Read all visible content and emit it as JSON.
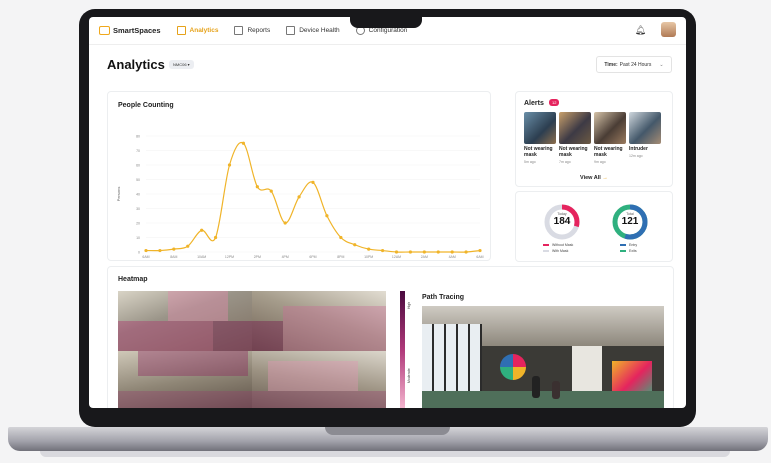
{
  "nav": {
    "brand": "SmartSpaces",
    "items": [
      {
        "label": "Analytics",
        "active": true
      },
      {
        "label": "Reports",
        "active": false
      },
      {
        "label": "Device Health",
        "active": false
      },
      {
        "label": "Configuration",
        "active": false
      }
    ]
  },
  "header": {
    "title": "Analytics",
    "site": "NMC06 ▾",
    "time_label": "Time:",
    "time_value": "Past 24 Hours"
  },
  "people_counting": {
    "title": "People Counting",
    "ylabel": "Persons",
    "chart_data": {
      "type": "line",
      "x": [
        "6AM",
        "7AM",
        "8AM",
        "9AM",
        "10AM",
        "11AM",
        "12PM",
        "1PM",
        "2PM",
        "3PM",
        "4PM",
        "5PM",
        "6PM",
        "7PM",
        "8PM",
        "9PM",
        "10PM",
        "11PM",
        "12AM",
        "1AM",
        "2AM",
        "3AM",
        "4AM",
        "5AM",
        "6AM"
      ],
      "x_ticks": [
        "6AM",
        "8AM",
        "10AM",
        "12PM",
        "2PM",
        "4PM",
        "6PM",
        "8PM",
        "10PM",
        "12AM",
        "2AM",
        "4AM",
        "6AM"
      ],
      "series": [
        {
          "values": [
            1,
            1,
            2,
            4,
            15,
            10,
            60,
            75,
            45,
            42,
            20,
            38,
            48,
            25,
            10,
            5,
            2,
            1,
            0,
            0,
            0,
            0,
            0,
            0,
            1
          ]
        }
      ],
      "ylim": [
        0,
        80
      ],
      "y_ticks": [
        0,
        10,
        20,
        30,
        40,
        50,
        60,
        70,
        80
      ],
      "color": "#f0b429"
    }
  },
  "alerts": {
    "title": "Alerts",
    "count": "12",
    "items": [
      {
        "label": "Not wearing mask",
        "time": "5m ago"
      },
      {
        "label": "Not wearing mask",
        "time": "7m ago"
      },
      {
        "label": "Not wearing mask",
        "time": "9m ago"
      },
      {
        "label": "Intruder",
        "time": "12m ago"
      }
    ],
    "view_all": "View All"
  },
  "donuts": [
    {
      "caption": "Today",
      "value": "184",
      "legend": [
        "Without Mask",
        "With Mask"
      ],
      "colors": [
        "#e5245e",
        "#d9dbe3"
      ]
    },
    {
      "caption": "Total",
      "value": "121",
      "legend": [
        "Entry",
        "Exits"
      ],
      "colors": [
        "#2f6fb3",
        "#2fb07f"
      ]
    }
  ],
  "heatmap": {
    "title": "Heatmap",
    "levels": [
      "High",
      "Moderate"
    ]
  },
  "path_tracing": {
    "title": "Path Tracing"
  }
}
